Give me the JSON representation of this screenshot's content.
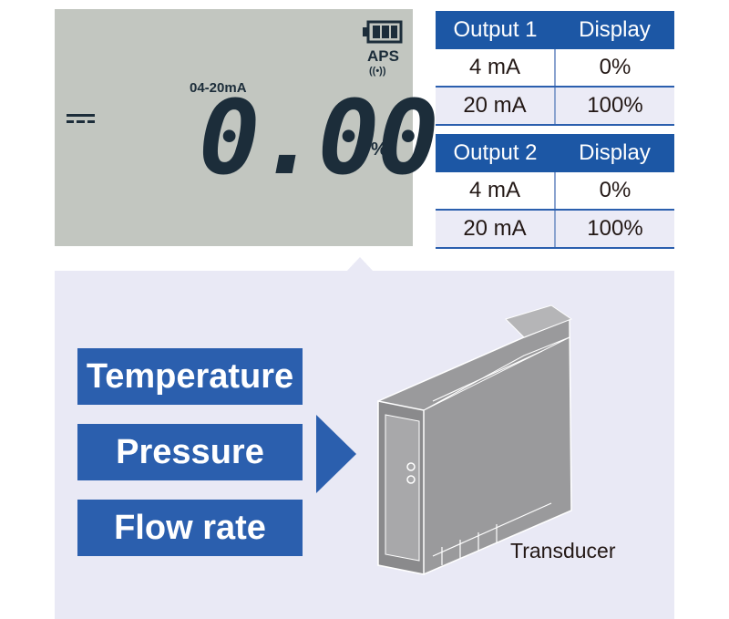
{
  "display": {
    "range_label": "04-20mA",
    "reading": "0.00",
    "unit": "%",
    "mode_label": "APS",
    "dc_symbol": "dc-icon",
    "battery_icon": "battery-full-icon",
    "wireless_icon": "wireless-signal-icon"
  },
  "tables": [
    {
      "header": [
        "Output 1",
        "Display"
      ],
      "rows": [
        [
          "4 mA",
          "0%"
        ],
        [
          "20 mA",
          "100%"
        ]
      ]
    },
    {
      "header": [
        "Output 2",
        "Display"
      ],
      "rows": [
        [
          "4 mA",
          "0%"
        ],
        [
          "20 mA",
          "100%"
        ]
      ]
    }
  ],
  "inputs": [
    "Temperature",
    "Pressure",
    "Flow rate"
  ],
  "device_label": "Transducer",
  "colors": {
    "header_blue": "#1c57a5",
    "label_blue": "#2b5fae",
    "lcd_bg": "#c2c6c0",
    "panel_bg": "#e9e9f5"
  }
}
